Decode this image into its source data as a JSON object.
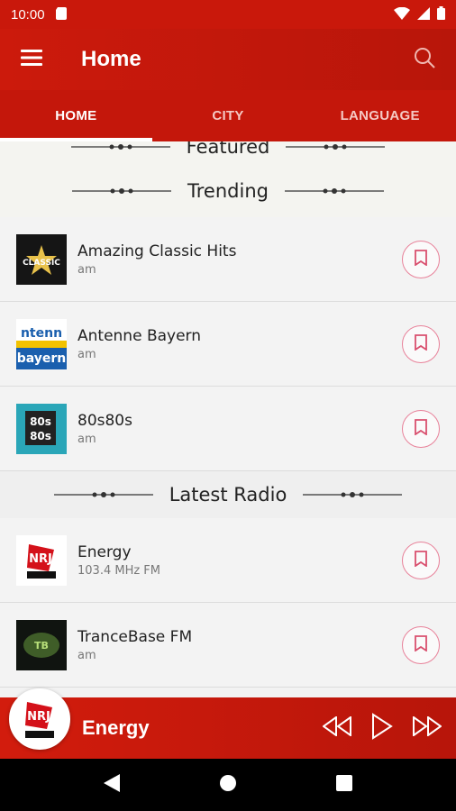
{
  "status": {
    "time": "10:00"
  },
  "header": {
    "title": "Home"
  },
  "tabs": [
    {
      "label": "HOME",
      "active": true
    },
    {
      "label": "CITY",
      "active": false
    },
    {
      "label": "LANGUAGE",
      "active": false
    }
  ],
  "sections": {
    "featured": "Featured",
    "trending": "Trending",
    "latest": "Latest Radio"
  },
  "trending": [
    {
      "title": "Amazing Classic Hits",
      "subtitle": "am",
      "logo_text": "CLASSIC"
    },
    {
      "title": "Antenne Bayern",
      "subtitle": "am",
      "logo_text": "ntenn bayern"
    },
    {
      "title": "80s80s",
      "subtitle": "am",
      "logo_text": "80s 80s"
    }
  ],
  "latest": [
    {
      "title": "Energy",
      "subtitle": "103.4 MHz FM",
      "logo_text": "NRJ"
    },
    {
      "title": "TranceBase FM",
      "subtitle": "am",
      "logo_text": "TB"
    }
  ],
  "player": {
    "title": "Energy"
  },
  "colors": {
    "primary": "#c9180b",
    "accent": "#e8829a"
  },
  "icons": {
    "menu": "menu-icon",
    "search": "search-icon",
    "bookmark": "bookmark-icon",
    "rewind": "rewind-icon",
    "play": "play-icon",
    "forward": "fast-forward-icon",
    "back": "nav-back-icon",
    "home": "nav-home-icon",
    "recents": "nav-recents-icon"
  }
}
